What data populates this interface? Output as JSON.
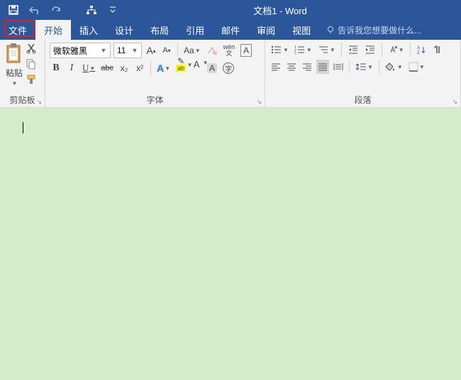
{
  "app": {
    "title": "文档1 - Word"
  },
  "tabs": {
    "file": "文件",
    "home": "开始",
    "insert": "插入",
    "design": "设计",
    "layout": "布局",
    "references": "引用",
    "mailings": "邮件",
    "review": "审阅",
    "view": "视图"
  },
  "tellme": "告诉我您想要做什么...",
  "groups": {
    "clipboard": "剪贴板",
    "font": "字体",
    "paragraph": "段落"
  },
  "clipboard": {
    "paste": "粘贴"
  },
  "font": {
    "name": "微软雅黑",
    "size": "11",
    "change_case": "Aa",
    "phonetic": "wén",
    "char_border": "A",
    "bold": "B",
    "italic": "I",
    "underline": "U",
    "strike": "abc",
    "subscript": "x₂",
    "superscript": "x²",
    "text_effect": "A",
    "highlight": "ab",
    "font_color": "A",
    "char_shading": "A",
    "enclose": "字"
  }
}
